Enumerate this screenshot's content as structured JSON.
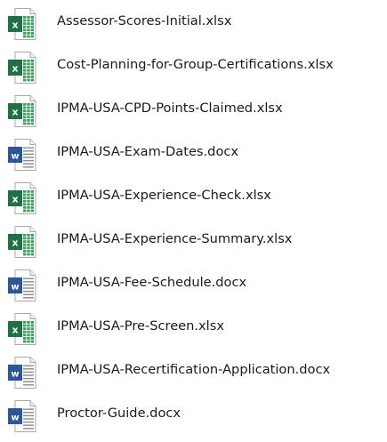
{
  "files": [
    {
      "name": "Assessor-Scores-Initial.xlsx",
      "type": "excel",
      "icon": "excel-file-icon"
    },
    {
      "name": "Cost-Planning-for-Group-Certifications.xlsx",
      "type": "excel",
      "icon": "excel-file-icon"
    },
    {
      "name": "IPMA-USA-CPD-Points-Claimed.xlsx",
      "type": "excel",
      "icon": "excel-file-icon"
    },
    {
      "name": "IPMA-USA-Exam-Dates.docx",
      "type": "word",
      "icon": "word-file-icon"
    },
    {
      "name": "IPMA-USA-Experience-Check.xlsx",
      "type": "excel",
      "icon": "excel-file-icon"
    },
    {
      "name": "IPMA-USA-Experience-Summary.xlsx",
      "type": "excel",
      "icon": "excel-file-icon"
    },
    {
      "name": "IPMA-USA-Fee-Schedule.docx",
      "type": "word",
      "icon": "word-file-icon"
    },
    {
      "name": "IPMA-USA-Pre-Screen.xlsx",
      "type": "excel",
      "icon": "excel-file-icon"
    },
    {
      "name": "IPMA-USA-Recertification-Application.docx",
      "type": "word",
      "icon": "word-file-icon"
    },
    {
      "name": "Proctor-Guide.docx",
      "type": "word",
      "icon": "word-file-icon"
    }
  ],
  "colors": {
    "excel_badge": "#1e7145",
    "excel_grid": "#3f9b5f",
    "word_badge": "#2b579a",
    "word_lines": "#8a8a8a",
    "text": "#1a1a1a"
  }
}
